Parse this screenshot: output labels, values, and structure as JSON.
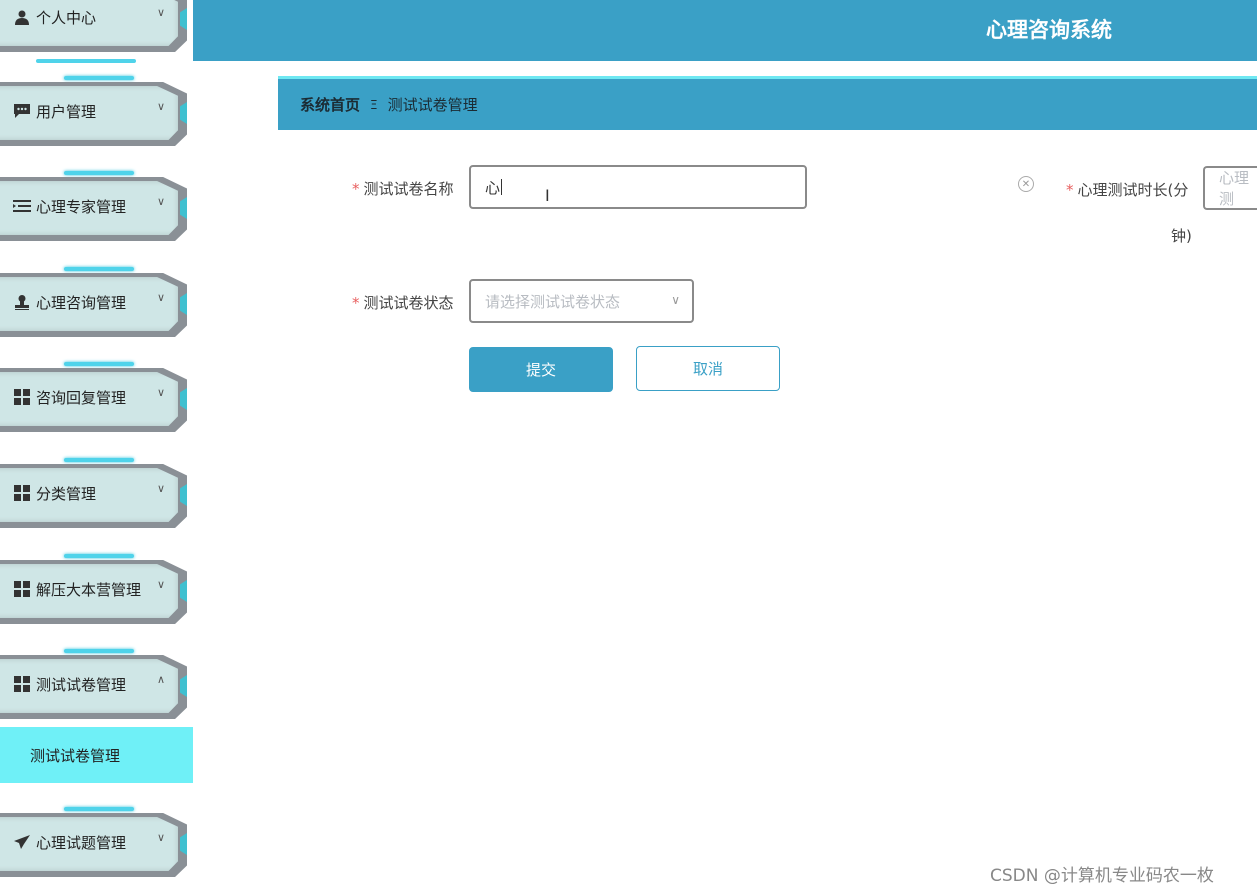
{
  "header": {
    "title": "心理咨询系统"
  },
  "sidebar": {
    "items": [
      {
        "label": "个人中心",
        "icon": "user-icon"
      },
      {
        "label": "用户管理",
        "icon": "chat-icon"
      },
      {
        "label": "心理专家管理",
        "icon": "list-icon"
      },
      {
        "label": "心理咨询管理",
        "icon": "stamp-icon"
      },
      {
        "label": "咨询回复管理",
        "icon": "grid-icon"
      },
      {
        "label": "分类管理",
        "icon": "grid-icon"
      },
      {
        "label": "解压大本营管理",
        "icon": "grid-icon"
      },
      {
        "label": "测试试卷管理",
        "icon": "grid-icon"
      },
      {
        "label": "心理试题管理",
        "icon": "send-icon"
      }
    ],
    "active_submenu": "测试试卷管理"
  },
  "breadcrumb": {
    "home": "系统首页",
    "separator": "Ξ",
    "current": "测试试卷管理"
  },
  "form": {
    "name_label": "测试试卷名称",
    "name_value": "心",
    "duration_label_line1": "心理测试时长(分",
    "duration_label_line2": "钟)",
    "duration_placeholder": "心理测",
    "status_label": "测试试卷状态",
    "status_placeholder": "请选择测试试卷状态",
    "required_mark": "*",
    "submit_label": "提交",
    "cancel_label": "取消"
  },
  "watermark": "CSDN @计算机专业码农一枚",
  "colors": {
    "primary": "#3aa0c6",
    "accent": "#6ff0f7",
    "required": "#e86060"
  }
}
